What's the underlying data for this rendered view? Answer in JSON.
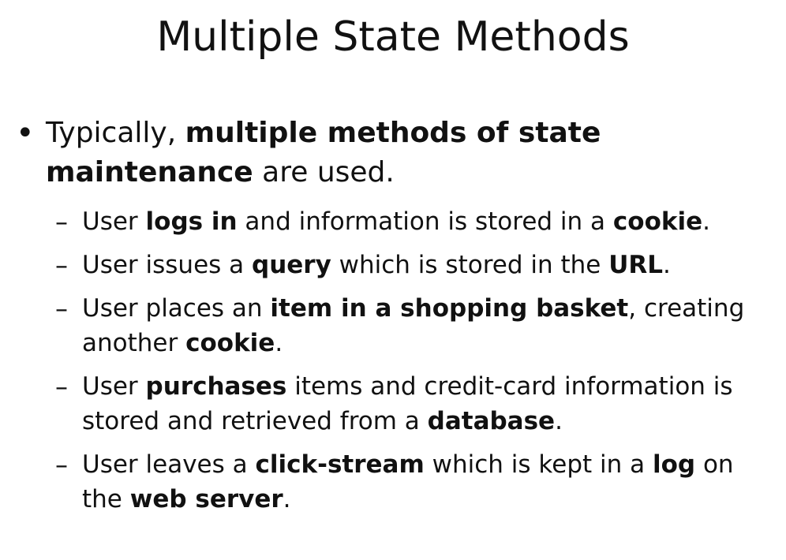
{
  "slide": {
    "title": "Multiple State Methods",
    "bullet_glyph": "•",
    "dash_glyph": "–",
    "main_point": {
      "t1": "Typically, ",
      "b1": "multiple methods of state maintenance",
      "t2": " are used."
    },
    "sub_points": [
      {
        "t1": "User ",
        "b1": "logs in",
        "t2": " and information is stored in a ",
        "b2": "cookie",
        "t3": "."
      },
      {
        "t1": "User issues a ",
        "b1": "query",
        "t2": " which is stored in the ",
        "b2": "URL",
        "t3": "."
      },
      {
        "t1": "User places an ",
        "b1": "item in a shopping basket",
        "t2": ", creating another ",
        "b2": "cookie",
        "t3": "."
      },
      {
        "t1": "User ",
        "b1": "purchases",
        "t2": " items and credit-card information is stored and retrieved from a ",
        "b2": "database",
        "t3": "."
      },
      {
        "t1": "User leaves a ",
        "b1": "click-stream",
        "t2": " which is kept in a ",
        "b2": "log",
        "t3": " on the ",
        "b3": "web server",
        "t4": "."
      }
    ]
  }
}
